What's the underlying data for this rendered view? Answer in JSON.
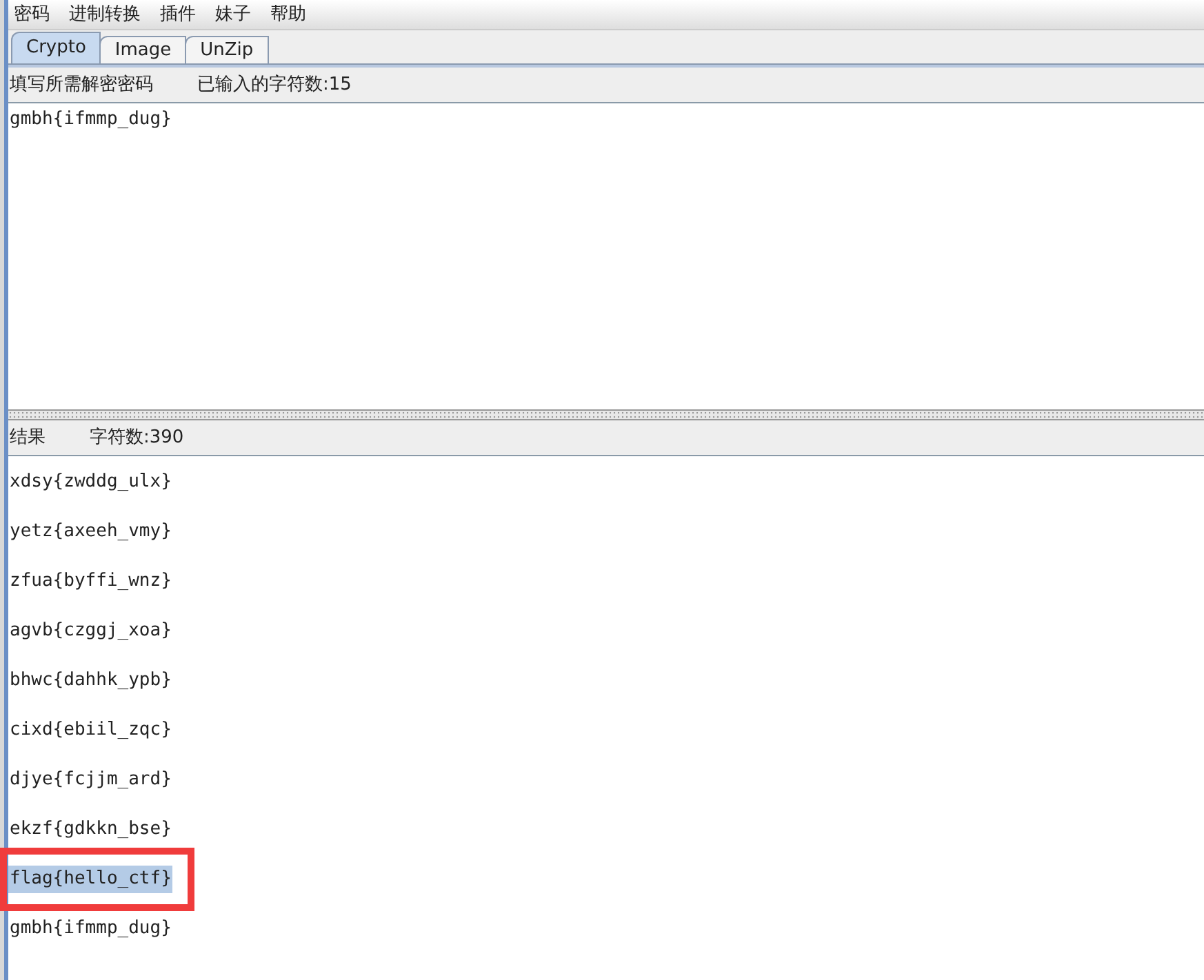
{
  "menu": [
    "密码",
    "进制转换",
    "插件",
    "妹子",
    "帮助"
  ],
  "tabs": [
    {
      "label": "Crypto",
      "selected": true
    },
    {
      "label": "Image",
      "selected": false
    },
    {
      "label": "UnZip",
      "selected": false
    }
  ],
  "input_panel": {
    "label": "填写所需解密密码",
    "count": "已输入的字符数:15",
    "value": "gmbh{ifmmp_dug}"
  },
  "result_panel": {
    "label": "结果",
    "count": "字符数:390",
    "lines": [
      {
        "text": "xdsy{zwddg_ulx}",
        "selected": false,
        "boxed": false
      },
      {
        "text": "yetz{axeeh_vmy}",
        "selected": false,
        "boxed": false
      },
      {
        "text": "zfua{byffi_wnz}",
        "selected": false,
        "boxed": false
      },
      {
        "text": "agvb{czggj_xoa}",
        "selected": false,
        "boxed": false
      },
      {
        "text": "bhwc{dahhk_ypb}",
        "selected": false,
        "boxed": false
      },
      {
        "text": "cixd{ebiil_zqc}",
        "selected": false,
        "boxed": false
      },
      {
        "text": "djye{fcjjm_ard}",
        "selected": false,
        "boxed": false
      },
      {
        "text": "ekzf{gdkkn_bse}",
        "selected": false,
        "boxed": false
      },
      {
        "text": "flag{hello_ctf}",
        "selected": true,
        "boxed": true
      },
      {
        "text": "gmbh{ifmmp_dug}",
        "selected": false,
        "boxed": false
      }
    ]
  }
}
